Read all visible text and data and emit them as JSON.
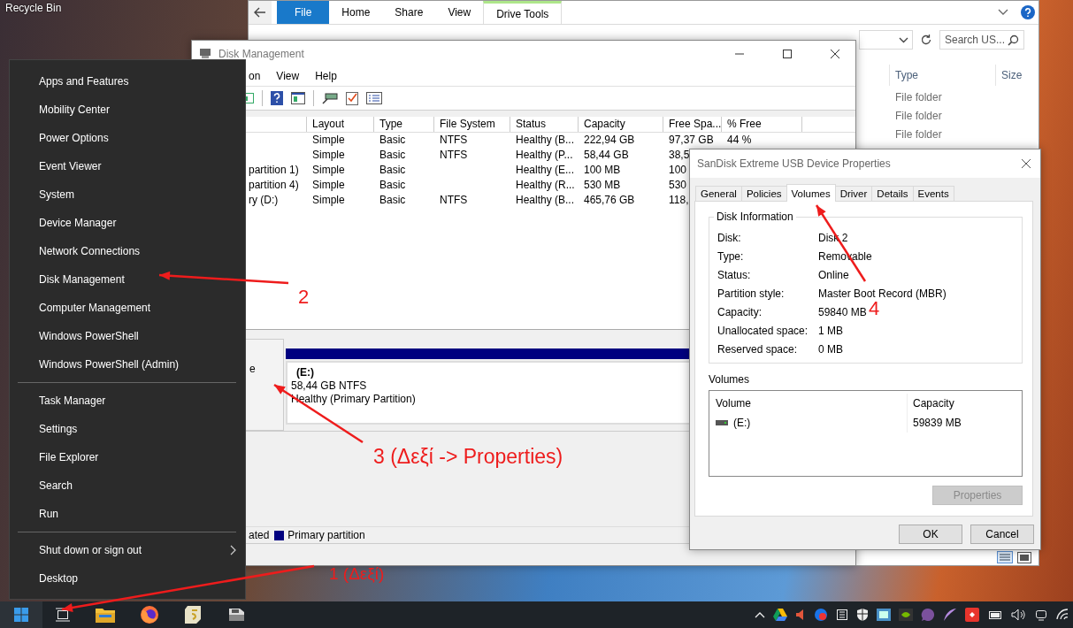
{
  "desktop": {
    "icon_label": "Recycle Bin"
  },
  "explorer": {
    "ribbon_tabs": [
      {
        "label": "File",
        "selected": true
      },
      {
        "label": "Home",
        "selected": false
      },
      {
        "label": "Share",
        "selected": false
      },
      {
        "label": "View",
        "selected": false
      },
      {
        "label": "Drive Tools",
        "selected": false
      }
    ],
    "search": {
      "placeholder": "Search US..."
    },
    "columns": [
      "Type",
      "Size"
    ],
    "rows": [
      "File folder",
      "File folder",
      "File folder"
    ]
  },
  "disk_management": {
    "title": "Disk Management",
    "menu": [
      "on",
      "View",
      "Help"
    ],
    "table": {
      "columns": [
        "Layout",
        "Type",
        "File System",
        "Status",
        "Capacity",
        "Free Spa...",
        "% Free"
      ],
      "rows": [
        {
          "volume": null,
          "cells": [
            "Simple",
            "Basic",
            "NTFS",
            "Healthy (B...",
            "222,94 GB",
            "97,37 GB",
            "44 %"
          ]
        },
        {
          "volume": null,
          "cells": [
            "Simple",
            "Basic",
            "NTFS",
            "Healthy (P...",
            "58,44 GB",
            "38,5",
            null
          ]
        },
        {
          "volume": "partition 1)",
          "cells": [
            "Simple",
            "Basic",
            null,
            "Healthy (E...",
            "100 MB",
            "100",
            null
          ]
        },
        {
          "volume": "partition 4)",
          "cells": [
            "Simple",
            "Basic",
            null,
            "Healthy (R...",
            "530 MB",
            "530",
            null
          ]
        },
        {
          "volume": "ry (D:)",
          "cells": [
            "Simple",
            "Basic",
            "NTFS",
            "Healthy (B...",
            "465,76 GB",
            "118,",
            null
          ]
        }
      ]
    },
    "disk_label": "e",
    "partition": {
      "name": "(E:)",
      "size": "58,44 GB NTFS",
      "status": "Healthy (Primary Partition)",
      "color": "#000080"
    },
    "legend": [
      {
        "label": "ated"
      },
      {
        "label": "Primary partition",
        "color": "#000080"
      }
    ]
  },
  "properties_dialog": {
    "title": "SanDisk Extreme USB Device Properties",
    "tabs": [
      {
        "label": "General",
        "selected": false
      },
      {
        "label": "Policies",
        "selected": false
      },
      {
        "label": "Volumes",
        "selected": true
      },
      {
        "label": "Driver",
        "selected": false
      },
      {
        "label": "Details",
        "selected": false
      },
      {
        "label": "Events",
        "selected": false
      }
    ],
    "group_title": "Disk Information",
    "info": [
      {
        "label": "Disk:",
        "value": "Disk 2"
      },
      {
        "label": "Type:",
        "value": "Removable"
      },
      {
        "label": "Status:",
        "value": "Online"
      },
      {
        "label": "Partition style:",
        "value": "Master Boot Record (MBR)"
      },
      {
        "label": "Capacity:",
        "value": "59840 MB"
      },
      {
        "label": "Unallocated space:",
        "value": "1 MB"
      },
      {
        "label": "Reserved space:",
        "value": "0 MB"
      }
    ],
    "volumes_label": "Volumes",
    "volume_columns": [
      "Volume",
      "Capacity"
    ],
    "volumes": [
      {
        "name": "(E:)",
        "capacity": "59839 MB"
      }
    ],
    "properties_button": {
      "label": "Properties",
      "disabled": true
    },
    "buttons": [
      "OK",
      "Cancel"
    ]
  },
  "start_menu": {
    "sections": [
      [
        {
          "label": "Apps and Features",
          "kind": "item"
        },
        {
          "label": "Mobility Center",
          "kind": "item"
        },
        {
          "label": "Power Options",
          "kind": "item"
        },
        {
          "label": "Event Viewer",
          "kind": "item"
        },
        {
          "label": "System",
          "kind": "item"
        },
        {
          "label": "Device Manager",
          "kind": "item"
        },
        {
          "label": "Network Connections",
          "kind": "item"
        },
        {
          "label": "Disk Management",
          "kind": "item"
        },
        {
          "label": "Computer Management",
          "kind": "item"
        },
        {
          "label": "Windows PowerShell",
          "kind": "item"
        },
        {
          "label": "Windows PowerShell (Admin)",
          "kind": "item"
        }
      ],
      [
        {
          "label": "Task Manager",
          "kind": "item"
        },
        {
          "label": "Settings",
          "kind": "item"
        },
        {
          "label": "File Explorer",
          "kind": "item"
        },
        {
          "label": "Search",
          "kind": "item"
        },
        {
          "label": "Run",
          "kind": "item"
        }
      ],
      [
        {
          "label": "Shut down or sign out",
          "kind": "submenu"
        },
        {
          "label": "Desktop",
          "kind": "item"
        }
      ]
    ]
  },
  "annotations": [
    {
      "label": "1 (Δεξί)"
    },
    {
      "label": "2"
    },
    {
      "label": "3 (Δεξί -> Properties)"
    },
    {
      "label": "4"
    }
  ]
}
